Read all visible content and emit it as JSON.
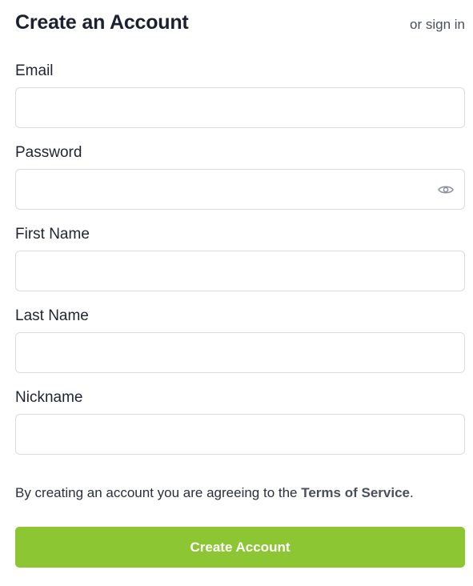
{
  "header": {
    "title": "Create an Account",
    "signin_link": "or sign in"
  },
  "form": {
    "fields": [
      {
        "label": "Email",
        "value": "",
        "placeholder": ""
      },
      {
        "label": "Password",
        "value": "",
        "placeholder": "",
        "icon": "eye-icon"
      },
      {
        "label": "First Name",
        "value": "",
        "placeholder": ""
      },
      {
        "label": "Last Name",
        "value": "",
        "placeholder": ""
      },
      {
        "label": "Nickname",
        "value": "",
        "placeholder": ""
      }
    ],
    "terms_prefix": "By creating an account you are agreeing to the ",
    "terms_link": "Terms of Service",
    "terms_suffix": ".",
    "submit_label": "Create Account"
  },
  "colors": {
    "accent": "#8cc633",
    "title_text": "#1c2030",
    "input_border": "#d9dce1"
  }
}
